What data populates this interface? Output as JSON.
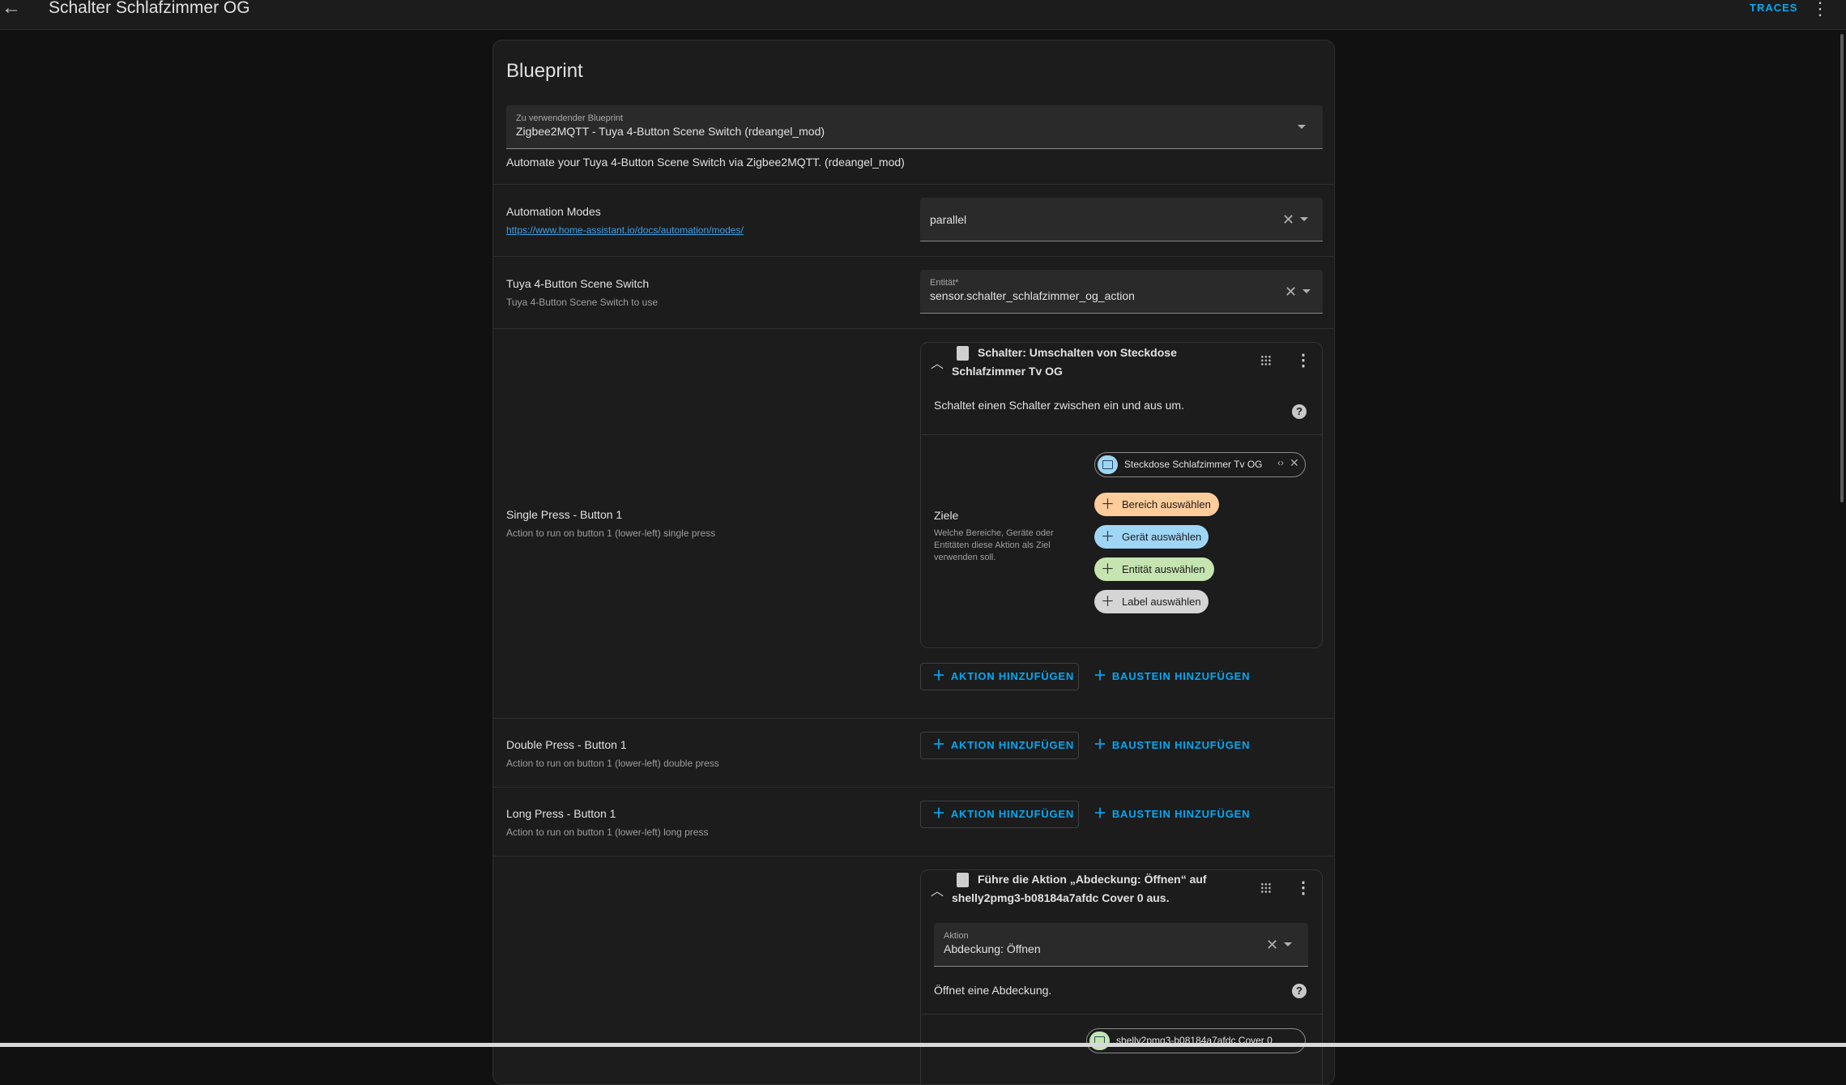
{
  "header": {
    "title": "Schalter Schlafzimmer OG",
    "traces_label": "TRACES"
  },
  "blueprint": {
    "title": "Blueprint",
    "select_label": "Zu verwendender Blueprint",
    "select_value": "Zigbee2MQTT - Tuya 4-Button Scene Switch (rdeangel_mod)",
    "description": "Automate your Tuya 4-Button Scene Switch via Zigbee2MQTT. (rdeangel_mod)"
  },
  "automation_modes": {
    "title": "Automation Modes",
    "link": "https://www.home-assistant.io/docs/automation/modes/",
    "value": "parallel"
  },
  "switch_input": {
    "title": "Tuya 4-Button Scene Switch",
    "subtitle": "Tuya 4-Button Scene Switch to use",
    "field_label": "Entität*",
    "field_value": "sensor.schalter_schlafzimmer_og_action"
  },
  "single_press": {
    "title": "Single Press - Button 1",
    "subtitle": "Action to run on button 1 (lower-left) single press",
    "action": {
      "title": "Schalter: Umschalten von Steckdose Schlafzimmer Tv OG",
      "description": "Schaltet einen Schalter zwischen ein und aus um.",
      "targets_title": "Ziele",
      "targets_desc": "Welche Bereiche, Geräte oder Entitäten diese Aktion als Ziel verwenden soll.",
      "target_chip": "Steckdose Schlafzimmer Tv OG",
      "chips": {
        "area": "Bereich auswählen",
        "device": "Gerät auswählen",
        "entity": "Entität auswählen",
        "label": "Label auswählen"
      }
    }
  },
  "buttons": {
    "add_action": "AKTION HINZUFÜGEN",
    "add_block": "BAUSTEIN HINZUFÜGEN"
  },
  "double_press": {
    "title": "Double Press - Button 1",
    "subtitle": "Action to run on button 1 (lower-left) double press"
  },
  "long_press": {
    "title": "Long Press - Button 1",
    "subtitle": "Action to run on button 1 (lower-left) long press"
  },
  "cover_action": {
    "title": "Führe die Aktion „Abdeckung: Öffnen“ auf shelly2pmg3-b08184a7afdc Cover 0 aus.",
    "field_label": "Aktion",
    "field_value": "Abdeckung: Öffnen",
    "description": "Öffnet eine Abdeckung.",
    "target_chip": "shelly2pmg3-b08184a7afdc Cover 0"
  },
  "colors": {
    "accent": "#03a9f4",
    "area_chip": "#ffcc9b",
    "device_chip": "#9fd5f5",
    "entity_chip": "#c5e4b0",
    "label_chip": "#d5d5d5"
  }
}
